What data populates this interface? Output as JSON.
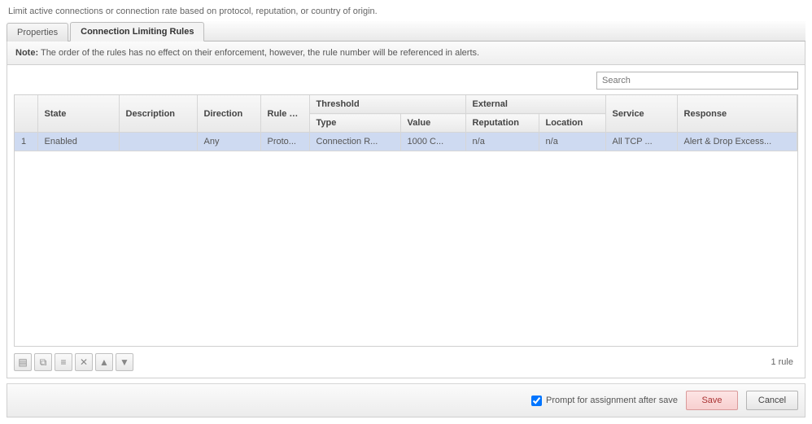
{
  "intro": "Limit active connections or connection rate based on protocol, reputation, or country of origin.",
  "tabs": {
    "properties": "Properties",
    "rules": "Connection Limiting Rules"
  },
  "note": {
    "label": "Note:",
    "text": "The order of the rules has no effect on their enforcement, however, the rule number will be referenced in alerts."
  },
  "search": {
    "placeholder": "Search"
  },
  "headers": {
    "state": "State",
    "description": "Description",
    "direction": "Direction",
    "ruleType": "Rule Type",
    "threshold": "Threshold",
    "thresholdType": "Type",
    "thresholdValue": "Value",
    "external": "External",
    "externalReputation": "Reputation",
    "externalLocation": "Location",
    "service": "Service",
    "response": "Response"
  },
  "rows": [
    {
      "num": "1",
      "state": "Enabled",
      "description": "",
      "direction": "Any",
      "ruleType": "Proto...",
      "thresholdType": "Connection R...",
      "thresholdValue": "1000 C...",
      "externalReputation": "n/a",
      "externalLocation": "n/a",
      "service": "All TCP ...",
      "response": "Alert & Drop Excess..."
    }
  ],
  "ruleCount": "1 rule",
  "footer": {
    "promptLabel": "Prompt for assignment after save",
    "save": "Save",
    "cancel": "Cancel"
  }
}
